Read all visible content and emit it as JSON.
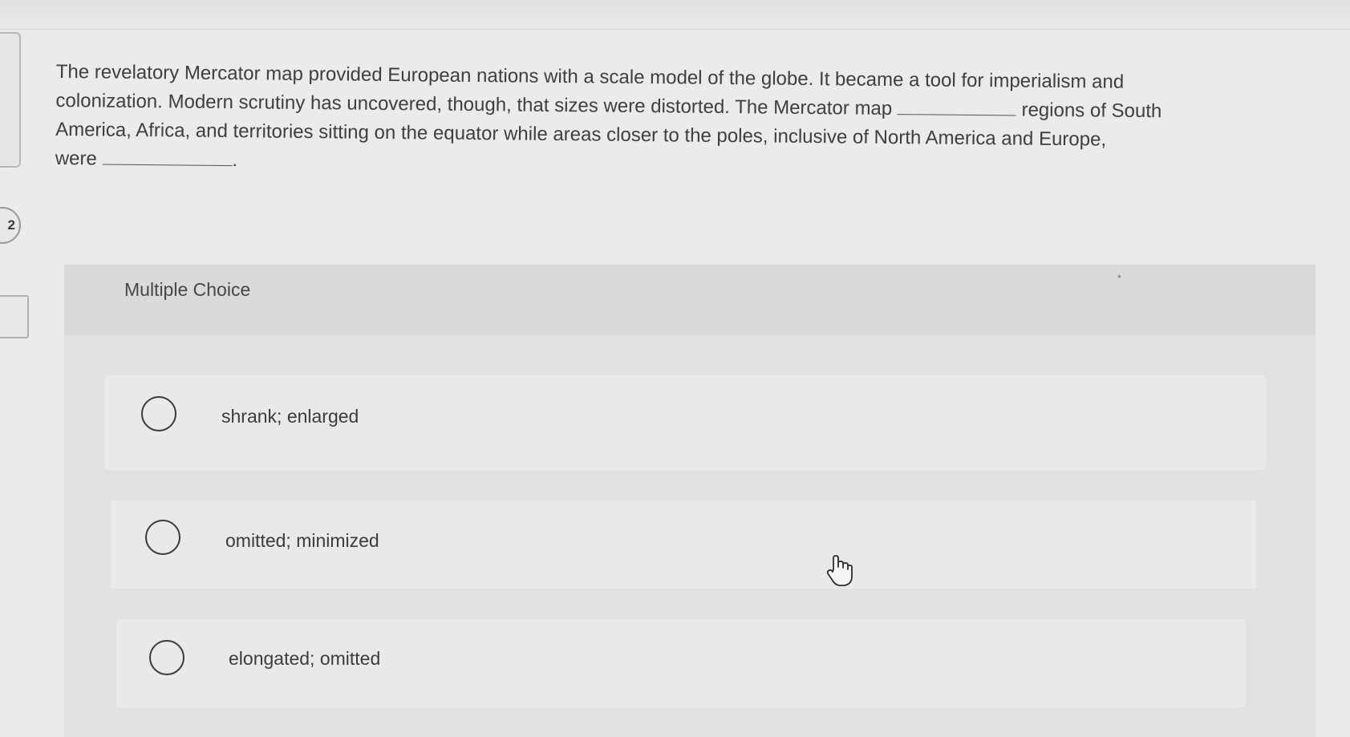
{
  "sidebar": {
    "question_number": "2"
  },
  "question": {
    "line1": "The revelatory Mercator map provided European nations with a scale model of the globe. It became a tool for imperialism and",
    "line2_a": "colonization. Modern scrutiny has uncovered, though, that sizes were distorted. The Mercator map",
    "line2_b": "regions of South",
    "line3": "America, Africa, and territories sitting on the equator while areas closer to the poles, inclusive of North America and Europe,",
    "line4_a": "were",
    "line4_b": "."
  },
  "multiple_choice": {
    "title": "Multiple Choice",
    "star": "*",
    "options": [
      {
        "label": "shrank; enlarged"
      },
      {
        "label": "omitted; minimized"
      },
      {
        "label": "elongated; omitted"
      }
    ]
  },
  "icons": {
    "cursor": "hand-pointer-icon"
  }
}
